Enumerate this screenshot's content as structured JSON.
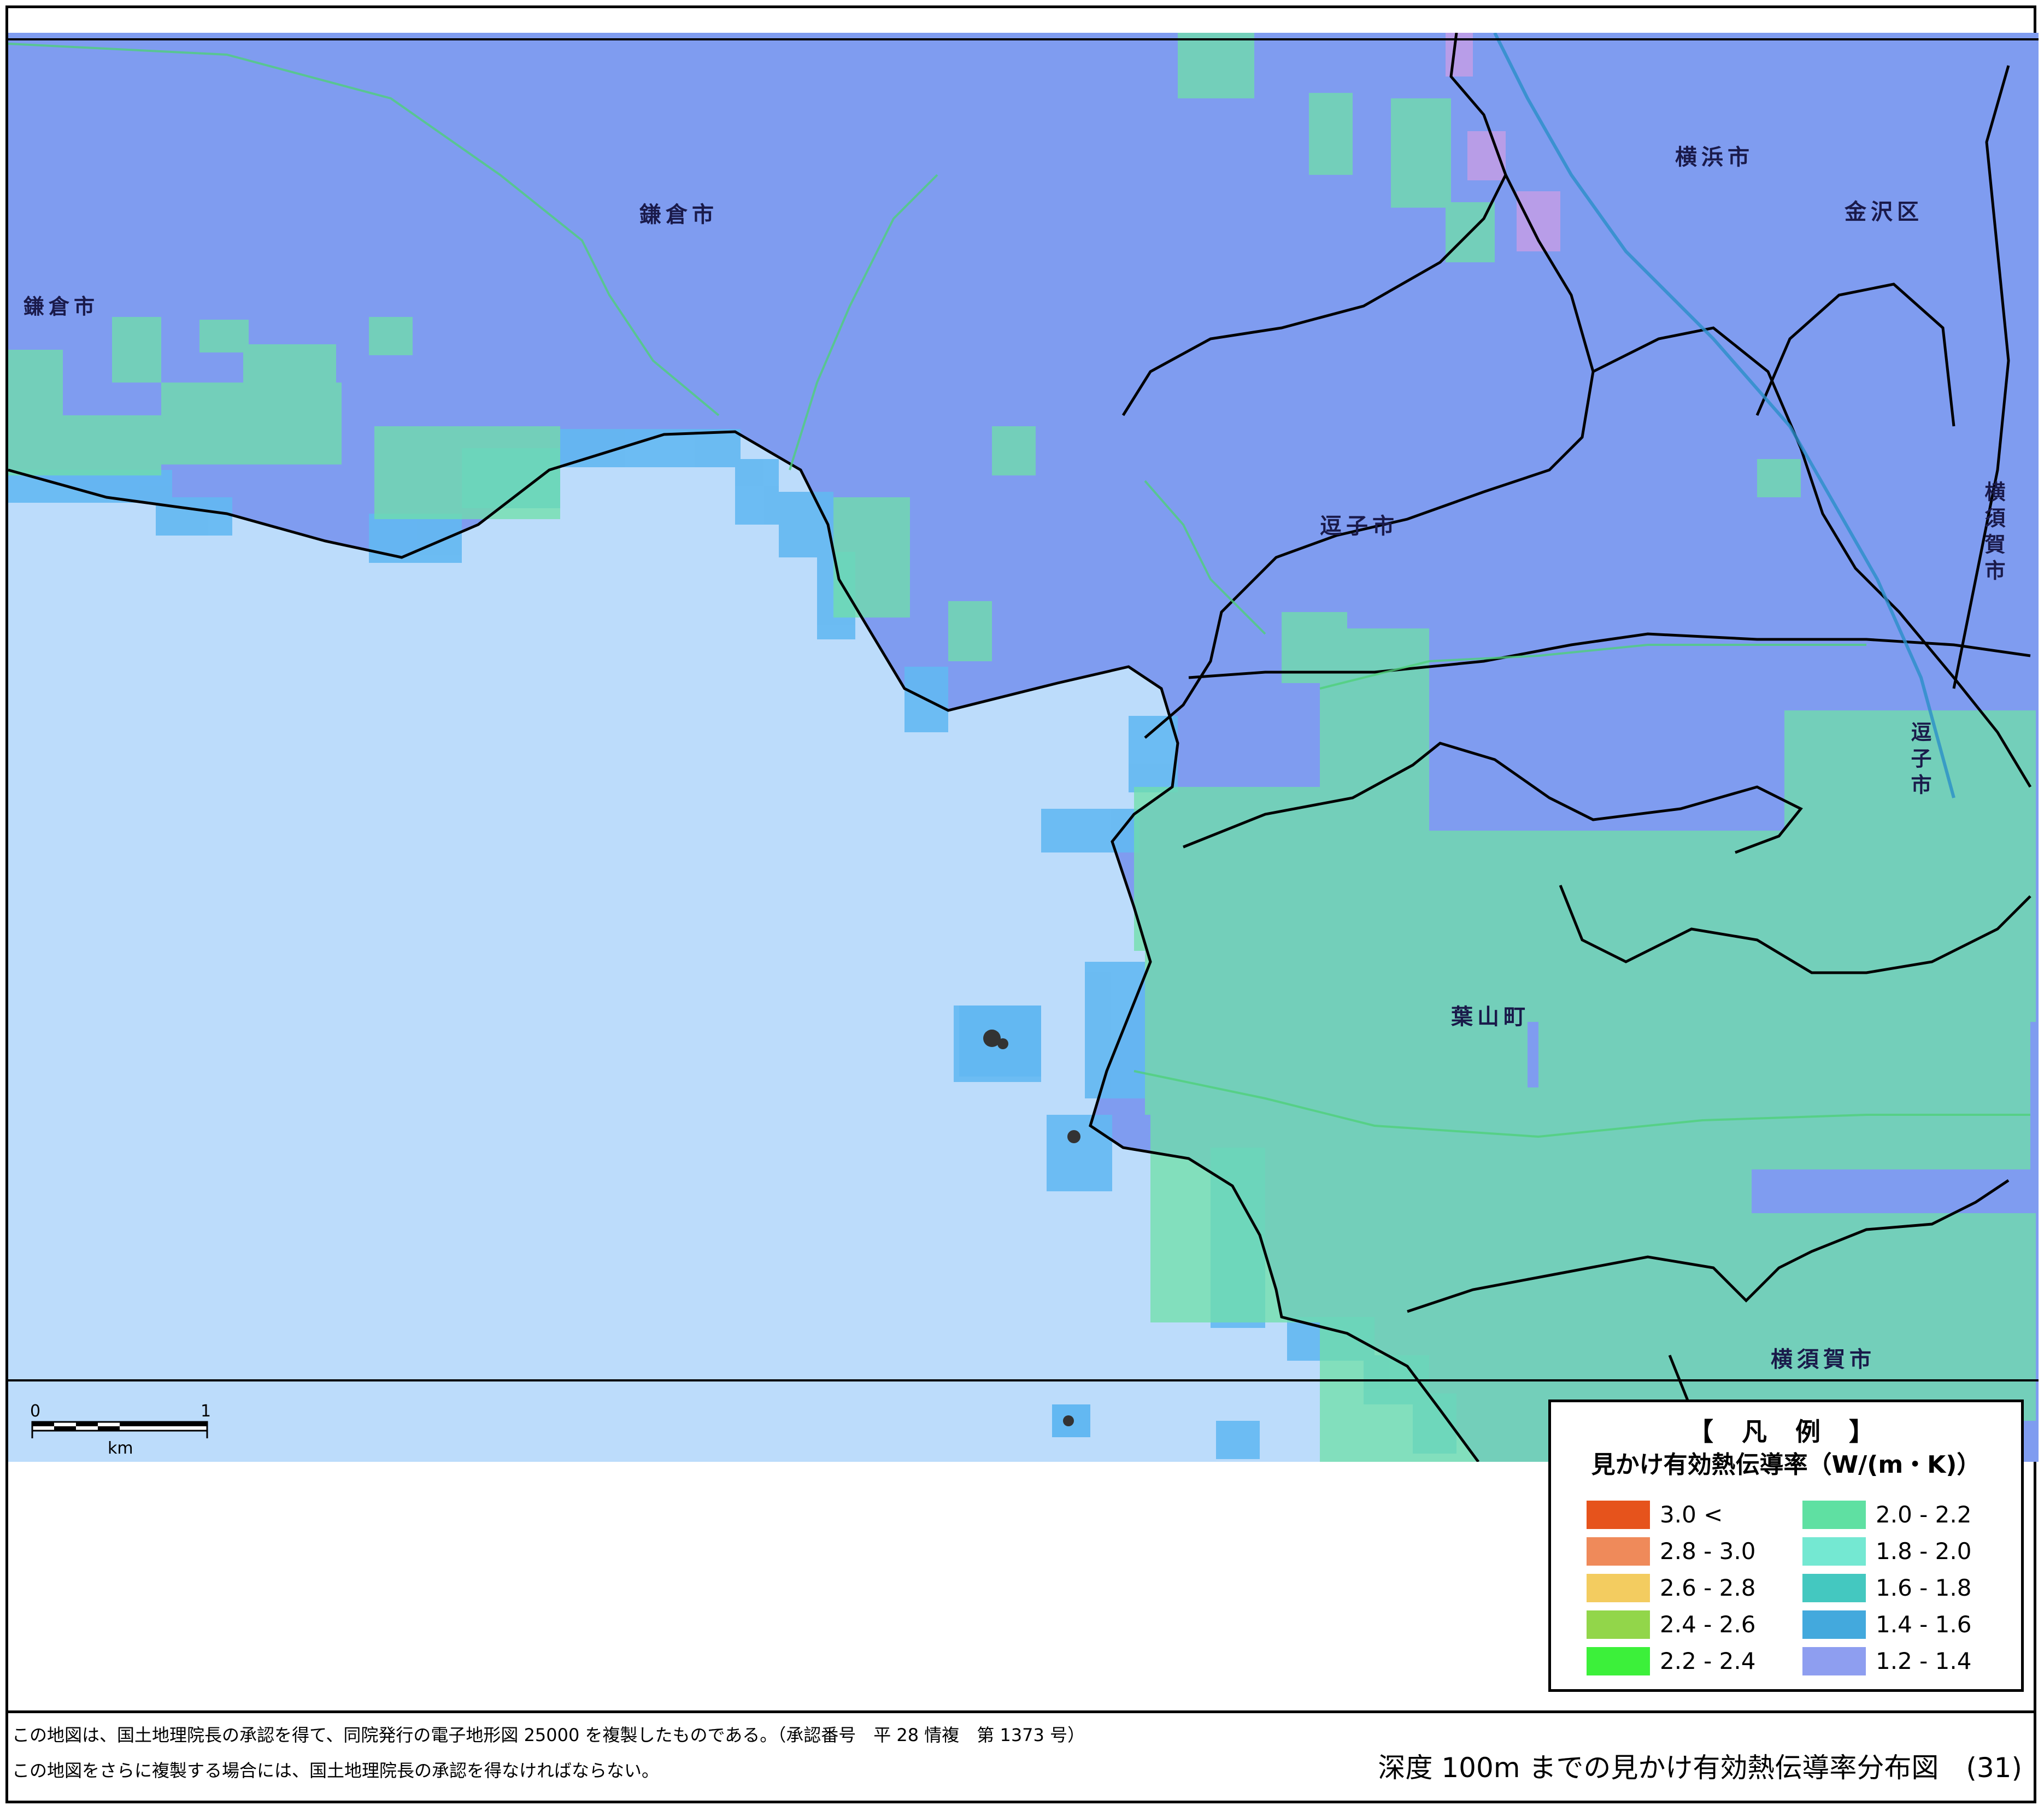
{
  "map": {
    "colors": {
      "sea": "#bcdcfb",
      "land_low": "#7f9cf0",
      "land_mid": "#66c9e8",
      "land_green": "#6fe0a8",
      "coast_shallow": "#63b8f2",
      "border": "#000000"
    },
    "place_labels": {
      "kamakura_city_center": "鎌倉市",
      "kamakura_city_west": "鎌倉市",
      "yokohama_city": "横浜市",
      "kanazawa_ward": "金沢区",
      "zushi_city_center": "逗子市",
      "zushi_city_east": "逗子市",
      "yokosuka_city_east": "横須賀市",
      "yokosuka_city_south": "横須賀市",
      "hayama_town": "葉山町"
    }
  },
  "scale": {
    "zero": "0",
    "one": "1",
    "unit": "km"
  },
  "legend": {
    "title": "【 凡 例 】",
    "subtitle": "見かけ有効熱伝導率（W/(m・K)）",
    "items": [
      {
        "label": "3.0  <",
        "color": "#e6531c"
      },
      {
        "label": "2.8  -  3.0",
        "color": "#ef8a5a"
      },
      {
        "label": "2.6  -  2.8",
        "color": "#f3cc60"
      },
      {
        "label": "2.4  -  2.6",
        "color": "#92d64a"
      },
      {
        "label": "2.2  -  2.4",
        "color": "#3cf03a"
      },
      {
        "label": "2.0  -  2.2",
        "color": "#5fe0a2"
      },
      {
        "label": "1.8  -  2.0",
        "color": "#74e8d2"
      },
      {
        "label": "1.6  -  1.8",
        "color": "#44c8c0"
      },
      {
        "label": "1.4  -  1.6",
        "color": "#43a9dd"
      },
      {
        "label": "1.2  -  1.4",
        "color": "#8e9ef0"
      }
    ]
  },
  "footer": {
    "note_line1": "この地図は、国土地理院長の承認を得て、同院発行の電子地形図 25000 を複製したものである。（承認番号　平 28 情複　第 1373 号）",
    "note_line2": "この地図をさらに複製する場合には、国土地理院長の承認を得なければならない。",
    "title": "深度 100m までの見かけ有効熱伝導率分布図　(31)"
  }
}
